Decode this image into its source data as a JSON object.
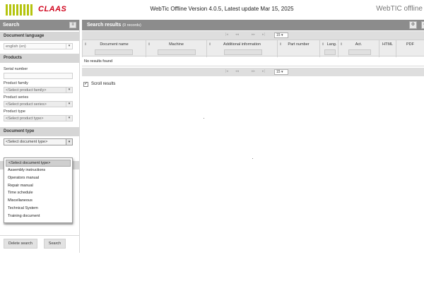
{
  "header": {
    "logo_text": "CLAAS",
    "title": "WebTic Offline Version 4.0.5, Latest update Mar 15, 2025",
    "brand": "WebTIC offline"
  },
  "search_panel": {
    "title": "Search",
    "collapse_icon": "≡",
    "document_language": {
      "section_title": "Document language",
      "value": "english (en)"
    },
    "products": {
      "section_title": "Products",
      "serial_number_label": "Serial number",
      "serial_number_value": "",
      "product_family_label": "Product family",
      "product_family_value": "<Select product family>",
      "product_series_label": "Product series",
      "product_series_value": "<Select product series>",
      "product_type_label": "Product type",
      "product_type_value": "<Select product type>"
    },
    "document_type": {
      "section_title": "Document type",
      "value": "<Select document type>",
      "options": [
        "<Select document type>",
        "Assembly instructions",
        "Operators manual",
        "Repair manual",
        "Time schedule",
        "Miscellaneous",
        "Technical System",
        "Training document"
      ],
      "selected_index": 0
    },
    "delete_button": "Delete search",
    "search_button": "Search"
  },
  "results": {
    "title": "Search results",
    "count_text": "(0 records)",
    "settings_icon": "gear-icon",
    "page_size": "15",
    "columns": [
      "Document name",
      "Machine",
      "Additional information",
      "Part number",
      "Lang.",
      "Act.",
      "HTML",
      "PDF"
    ],
    "no_results_text": "No results found",
    "scroll_results_label": "Scroll results",
    "scroll_results_checked": true
  }
}
